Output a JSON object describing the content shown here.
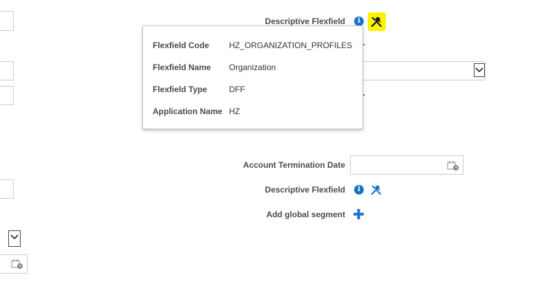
{
  "top_flexfield": {
    "label": "Descriptive Flexfield",
    "info_icon_glyph": "i",
    "tools_icon": "wrench-screwdriver-icon",
    "highlight_color": "#fff200"
  },
  "popup": {
    "rows": [
      {
        "key": "Flexfield Code",
        "value": "HZ_ORGANIZATION_PROFILES"
      },
      {
        "key": "Flexfield Name",
        "value": "Organization"
      },
      {
        "key": "Flexfield Type",
        "value": "DFF"
      },
      {
        "key": "Application Name",
        "value": "HZ"
      }
    ]
  },
  "account_termination": {
    "label": "Account Termination Date",
    "value": "",
    "icon": "calendar-icon"
  },
  "bottom_flexfield": {
    "label": "Descriptive Flexfield",
    "info_icon_glyph": "i",
    "tools_icon": "wrench-screwdriver-icon"
  },
  "add_segment": {
    "label": "Add global segment",
    "icon": "plus-icon"
  },
  "colors": {
    "accent": "#1a73c8",
    "label": "#4a4a4a",
    "border": "#c8ccd0"
  }
}
